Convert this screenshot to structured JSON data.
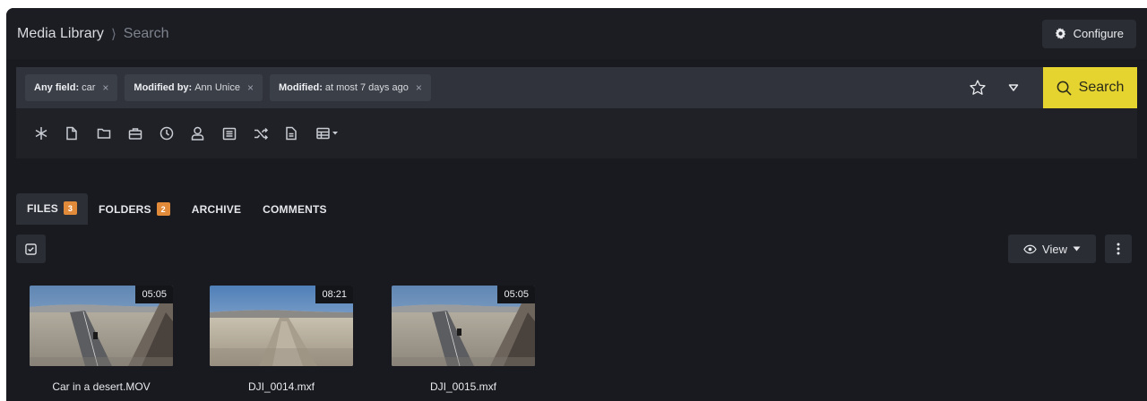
{
  "header": {
    "breadcrumb_root": "Media Library",
    "breadcrumb_sep": "⟩",
    "breadcrumb_current": "Search",
    "configure_label": "Configure"
  },
  "search": {
    "filters": [
      {
        "key": "Any field:",
        "value": "car"
      },
      {
        "key": "Modified by:",
        "value": "Ann Unice"
      },
      {
        "key": "Modified:",
        "value": "at most 7 days ago"
      }
    ],
    "remove_glyph": "×",
    "search_label": "Search",
    "accent_color": "#e5d42f"
  },
  "toolbar": {
    "icons": [
      "asterisk-icon",
      "file-icon",
      "folder-icon",
      "briefcase-icon",
      "clock-icon",
      "user-icon",
      "list-icon",
      "shuffle-icon",
      "document-icon",
      "table-icon"
    ]
  },
  "tabs": [
    {
      "label": "FILES",
      "count": "3"
    },
    {
      "label": "FOLDERS",
      "count": "2"
    },
    {
      "label": "ARCHIVE"
    },
    {
      "label": "COMMENTS"
    }
  ],
  "view": {
    "label": "View"
  },
  "files": [
    {
      "name": "Car in a desert.MOV",
      "duration": "05:05"
    },
    {
      "name": "DJI_0014.mxf",
      "duration": "08:21"
    },
    {
      "name": "DJI_0015.mxf",
      "duration": "05:05"
    }
  ]
}
